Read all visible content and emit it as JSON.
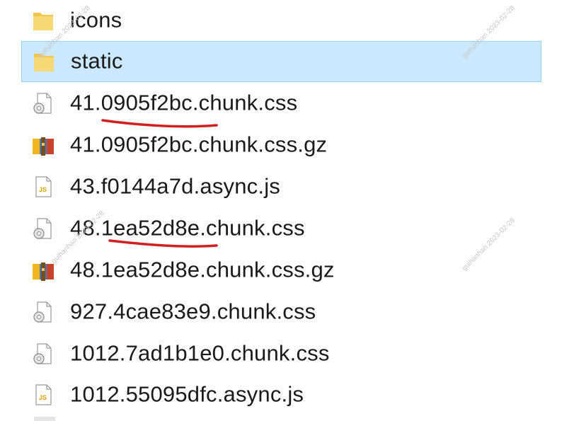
{
  "files": [
    {
      "name": "icons",
      "type": "folder",
      "selected": false
    },
    {
      "name": "static",
      "type": "folder",
      "selected": true
    },
    {
      "name": "41.0905f2bc.chunk.css",
      "type": "css",
      "selected": false
    },
    {
      "name": "41.0905f2bc.chunk.css.gz",
      "type": "archive",
      "selected": false
    },
    {
      "name": "43.f0144a7d.async.js",
      "type": "js",
      "selected": false
    },
    {
      "name": "48.1ea52d8e.chunk.css",
      "type": "css",
      "selected": false
    },
    {
      "name": "48.1ea52d8e.chunk.css.gz",
      "type": "archive",
      "selected": false
    },
    {
      "name": "927.4cae83e9.chunk.css",
      "type": "css",
      "selected": false
    },
    {
      "name": "1012.7ad1b1e0.chunk.css",
      "type": "css",
      "selected": false
    },
    {
      "name": "1012.55095dfc.async.js",
      "type": "js",
      "selected": false
    }
  ],
  "watermark_text": "guihanhan 2023-02-28",
  "colors": {
    "selection_bg": "#cce8ff",
    "selection_border": "#99d1ff",
    "annotation_red": "#d0201f",
    "folder_yellow": "#f8d775"
  }
}
